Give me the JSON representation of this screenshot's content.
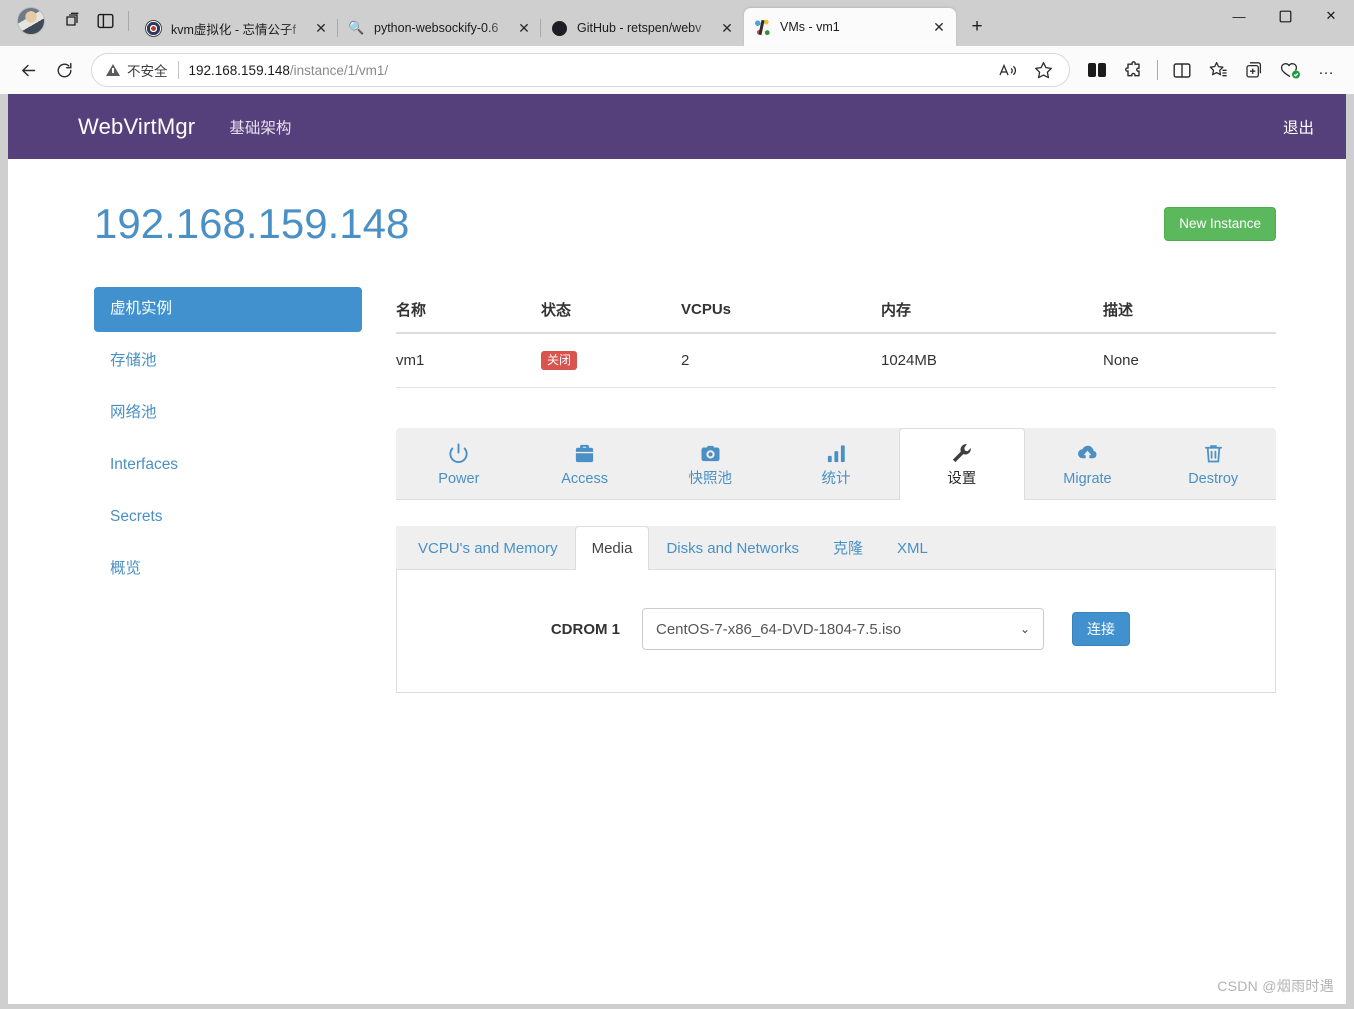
{
  "browser": {
    "tabs": [
      {
        "title": "kvm虚拟化 - 忘情公子f",
        "favicon": "kvm-icon",
        "active": false
      },
      {
        "title": "python-websockify-0.6",
        "favicon": "search-icon",
        "active": false
      },
      {
        "title": "GitHub - retspen/webv",
        "favicon": "github-icon",
        "active": false
      },
      {
        "title": "VMs - vm1",
        "favicon": "webvirtmgr-icon",
        "active": true
      }
    ],
    "new_tab_label": "+",
    "window_controls": {
      "minimize": "—",
      "maximize": "▢",
      "close": "✕"
    },
    "toolbar": {
      "back": "←",
      "reload": "⟳",
      "security_label": "不安全",
      "url_host": "192.168.159.148",
      "url_path": "/instance/1/vm1/",
      "read_aloud": "A",
      "favorite": "☆",
      "split_screen": "split-screen",
      "collections": "collections",
      "more": "…"
    }
  },
  "navbar": {
    "brand": "WebVirtMgr",
    "link": "基础架构",
    "logout": "退出"
  },
  "page": {
    "host_title": "192.168.159.148",
    "new_instance_label": "New Instance"
  },
  "sidebar": {
    "items": [
      {
        "label": "虚机实例",
        "active": true
      },
      {
        "label": "存储池",
        "active": false
      },
      {
        "label": "网络池",
        "active": false
      },
      {
        "label": "Interfaces",
        "active": false
      },
      {
        "label": "Secrets",
        "active": false
      },
      {
        "label": "概览",
        "active": false
      }
    ]
  },
  "table": {
    "headers": [
      "名称",
      "状态",
      "VCPUs",
      "内存",
      "描述"
    ],
    "rows": [
      {
        "name": "vm1",
        "state": "关闭",
        "vcpus": "2",
        "memory": "1024MB",
        "description": "None"
      }
    ]
  },
  "action_tabs": [
    {
      "label": "Power",
      "icon": "power-icon",
      "active": false
    },
    {
      "label": "Access",
      "icon": "briefcase-icon",
      "active": false
    },
    {
      "label": "快照池",
      "icon": "camera-icon",
      "active": false
    },
    {
      "label": "统计",
      "icon": "bar-chart-icon",
      "active": false
    },
    {
      "label": "设置",
      "icon": "wrench-icon",
      "active": true
    },
    {
      "label": "Migrate",
      "icon": "cloud-download-icon",
      "active": false
    },
    {
      "label": "Destroy",
      "icon": "trash-icon",
      "active": false
    }
  ],
  "sub_tabs": [
    {
      "label": "VCPU's and Memory",
      "active": false
    },
    {
      "label": "Media",
      "active": true
    },
    {
      "label": "Disks and Networks",
      "active": false
    },
    {
      "label": "克隆",
      "active": false
    },
    {
      "label": "XML",
      "active": false
    }
  ],
  "media_form": {
    "cdrom_label": "CDROM 1",
    "iso_value": "CentOS-7-x86_64-DVD-1804-7.5.iso",
    "connect_label": "连接"
  },
  "watermark": "CSDN @烟雨时遇",
  "colors": {
    "navbar_purple": "#55407c",
    "link_blue": "#4a90c4",
    "active_blue": "#4091ce",
    "success_green": "#5cb85c",
    "danger_red": "#d9534f"
  }
}
